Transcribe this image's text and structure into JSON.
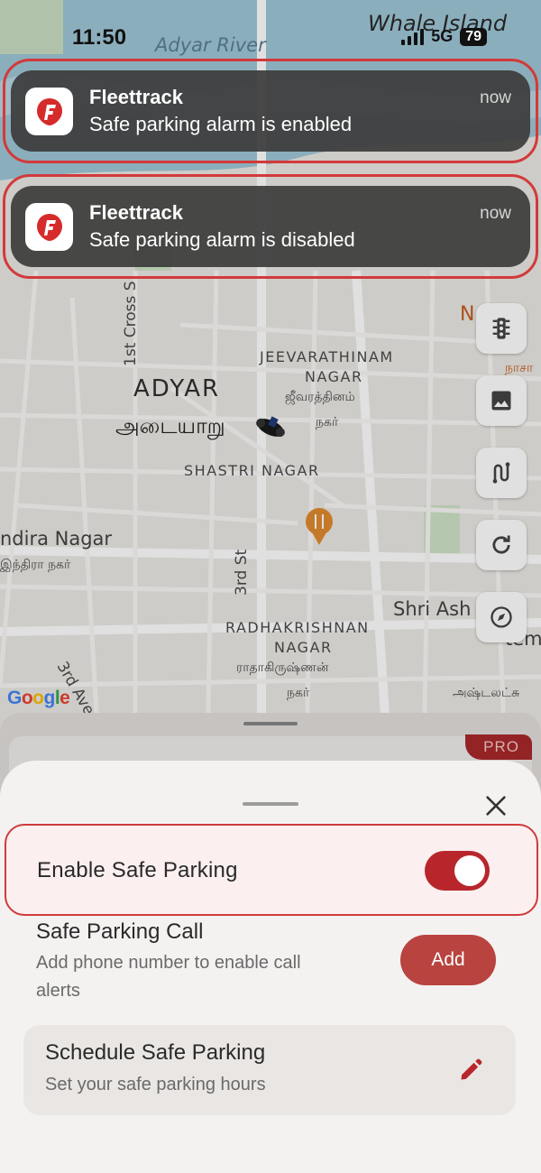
{
  "status_bar": {
    "time": "11:50",
    "network": "5G",
    "battery": "79"
  },
  "notifications": [
    {
      "app": "Fleettrack",
      "message": "Safe parking alarm is enabled",
      "time": "now"
    },
    {
      "app": "Fleettrack",
      "message": "Safe parking alarm is disabled",
      "time": "now"
    }
  ],
  "map": {
    "labels": {
      "adyar_river": "Adyar River",
      "whale_island": "Whale Island",
      "cross_st": "1st Cross S",
      "adyar": "ADYAR",
      "adyar_tamil": "அடையாறு",
      "jeevarathinam_1": "JEEVARATHINAM",
      "jeevarathinam_2": "NAGAR",
      "jeevarathinam_tamil_1": "ஜீவரத்தினம்",
      "jeevarathinam_tamil_2": "நகர்",
      "shastri": "SHASTRI NAGAR",
      "indira": "ndira Nagar",
      "indira_tamil": "இந்திரா நகர்",
      "third_st": "3rd St",
      "radhakrishnan_1": "RADHAKRISHNAN",
      "radhakrishnan_2": "NAGAR",
      "radhakrishnan_tamil_1": "ராதாகிருஷ்ணன்",
      "radhakrishnan_tamil_2": "நகர்",
      "shri_ash": "Shri Ash",
      "third_ave": "3rd Ave",
      "ashtalak": "அஷ்டலட்சு",
      "n_right": "N",
      "tamil_right": "நாசா",
      "temp_right": "temp",
      "google": "Google"
    },
    "tools": [
      "traffic-light-icon",
      "image-icon",
      "route-icon",
      "refresh-icon",
      "compass-icon"
    ]
  },
  "back_sheet": {
    "badge": "PRO"
  },
  "sheet": {
    "toggle_label": "Enable Safe Parking",
    "toggle_on": true,
    "call_title": "Safe Parking Call",
    "call_sub_1": "Add phone number to enable call",
    "call_sub_2": "alerts",
    "add_label": "Add",
    "schedule_title": "Schedule Safe Parking",
    "schedule_sub": "Set your safe parking hours"
  },
  "colors": {
    "accent": "#b8262c",
    "highlight_border": "#d23a3a",
    "notification_bg": "#3c3c3c"
  }
}
